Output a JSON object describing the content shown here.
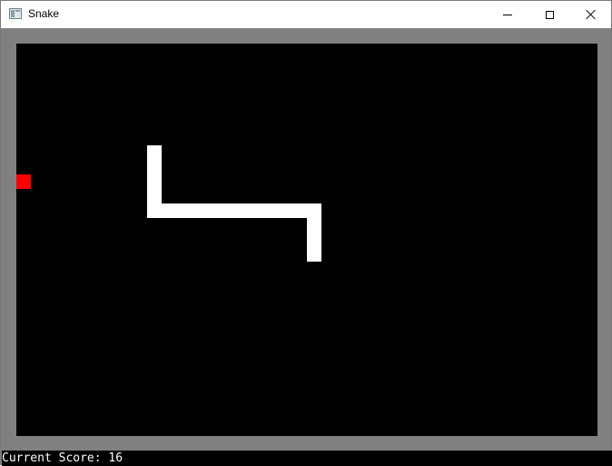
{
  "window": {
    "title": "Snake",
    "icon": "app-window-icon",
    "controls": {
      "minimize": "minimize-icon",
      "maximize": "maximize-icon",
      "close": "close-icon"
    }
  },
  "game": {
    "board_color": "#000000",
    "border_color": "#808080",
    "snake_color": "#ffffff",
    "food_color": "#ff0000"
  },
  "status": {
    "score_text": "Current Score: 16"
  }
}
